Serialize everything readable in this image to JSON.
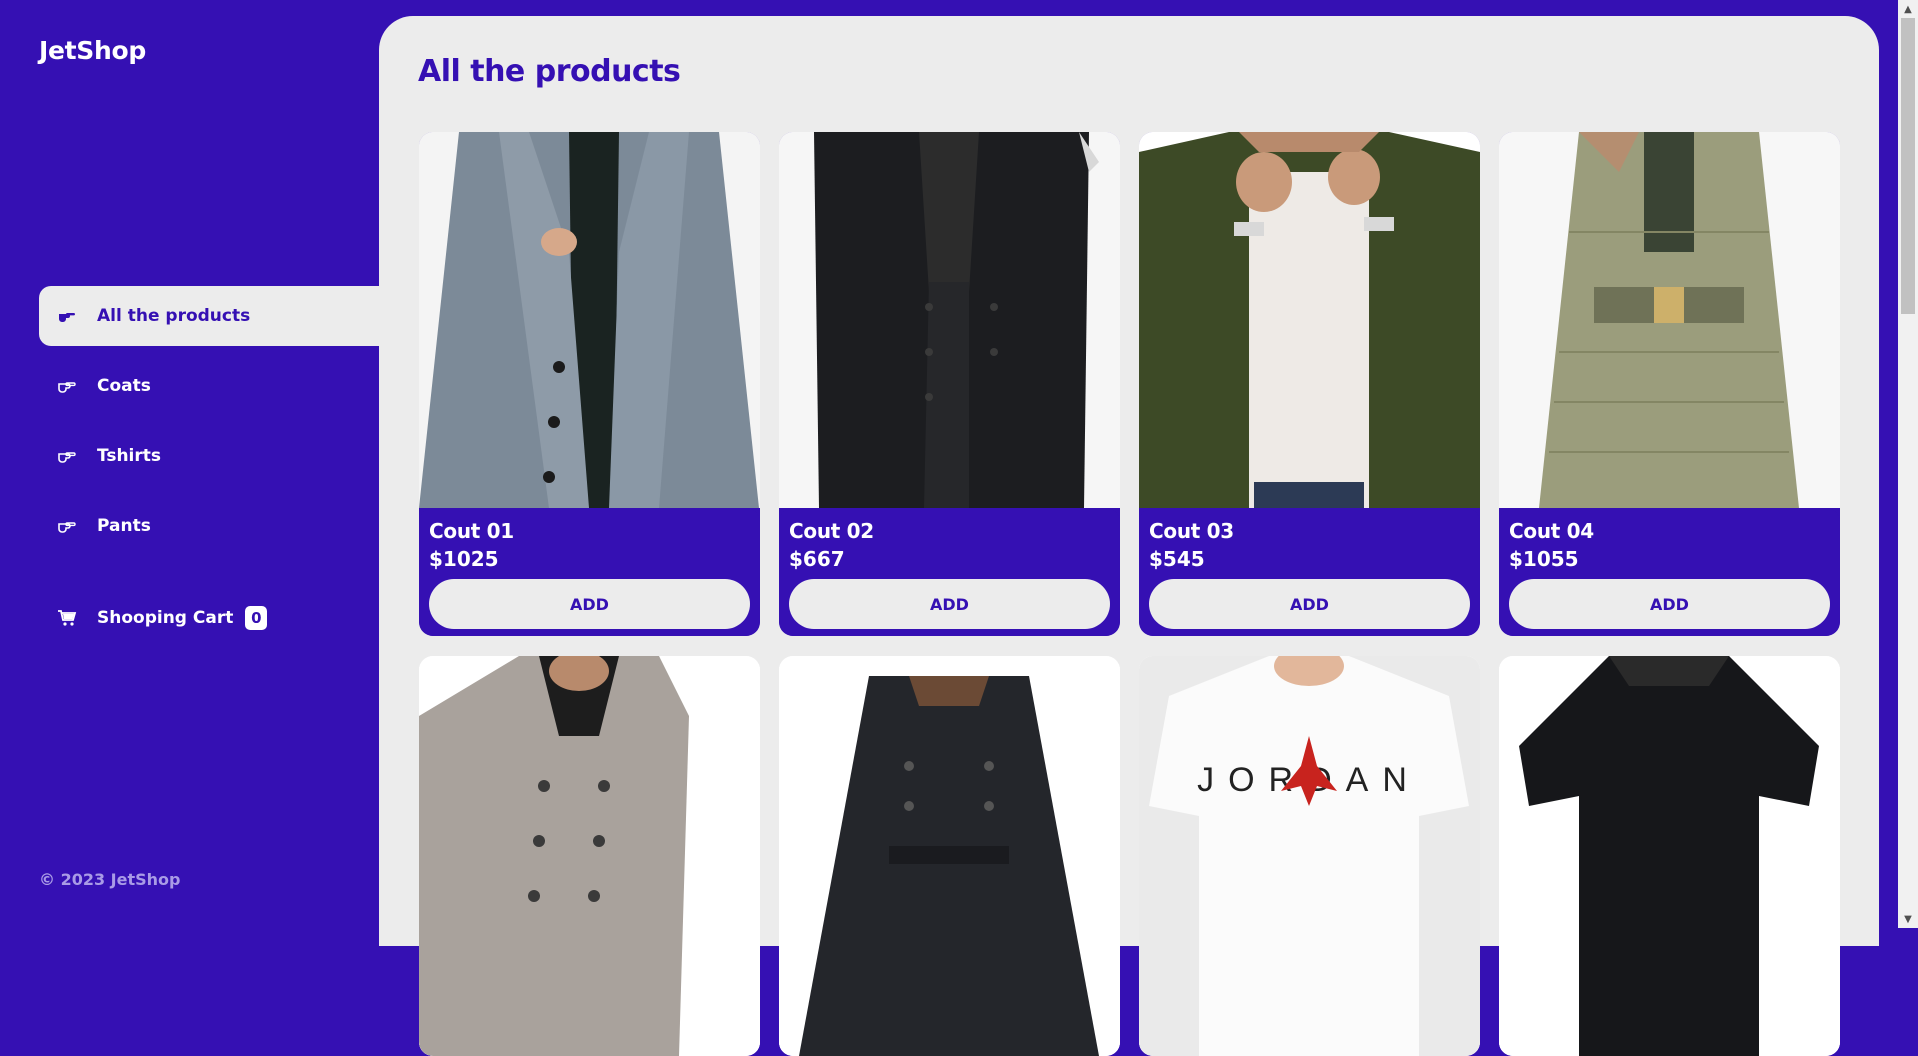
{
  "brand": "JetShop",
  "colors": {
    "primary": "#3510b3",
    "surface": "#ececec",
    "text_on_primary": "#ffffff"
  },
  "nav": {
    "items": [
      {
        "label": "All the products",
        "icon": "hand-pointer-icon",
        "active": true
      },
      {
        "label": "Coats",
        "icon": "hand-pointer-icon",
        "active": false
      },
      {
        "label": "Tshirts",
        "icon": "hand-pointer-icon",
        "active": false
      },
      {
        "label": "Pants",
        "icon": "hand-pointer-icon",
        "active": false
      }
    ]
  },
  "cart": {
    "label": "Shooping Cart",
    "count": "0",
    "icon": "shopping-cart-icon"
  },
  "footer": "© 2023 JetShop",
  "main": {
    "title": "All the products",
    "products": [
      {
        "name": "Cout 01",
        "price": "$1025",
        "button": "ADD",
        "image": "grey-wool-coat"
      },
      {
        "name": "Cout 02",
        "price": "$667",
        "button": "ADD",
        "image": "black-trench-coat"
      },
      {
        "name": "Cout 03",
        "price": "$545",
        "button": "ADD",
        "image": "olive-bomber-jacket"
      },
      {
        "name": "Cout 04",
        "price": "$1055",
        "button": "ADD",
        "image": "olive-puffer-coat"
      }
    ],
    "partial_products": [
      {
        "image": "grey-peacoat"
      },
      {
        "image": "black-double-breasted-coat"
      },
      {
        "image": "white-jordan-tshirt"
      },
      {
        "image": "black-tshirt"
      }
    ]
  }
}
